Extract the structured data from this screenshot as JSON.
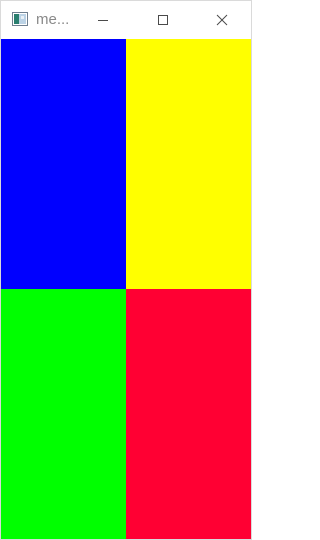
{
  "window": {
    "title": "me..."
  },
  "controls": {
    "minimize_icon": "minimize-icon",
    "maximize_icon": "maximize-icon",
    "close_icon": "close-icon"
  },
  "quadrants": [
    {
      "name": "top-left",
      "color": "#0000ff"
    },
    {
      "name": "top-right",
      "color": "#ffff00"
    },
    {
      "name": "bottom-left",
      "color": "#00ff00"
    },
    {
      "name": "bottom-right",
      "color": "#ff0033"
    }
  ]
}
